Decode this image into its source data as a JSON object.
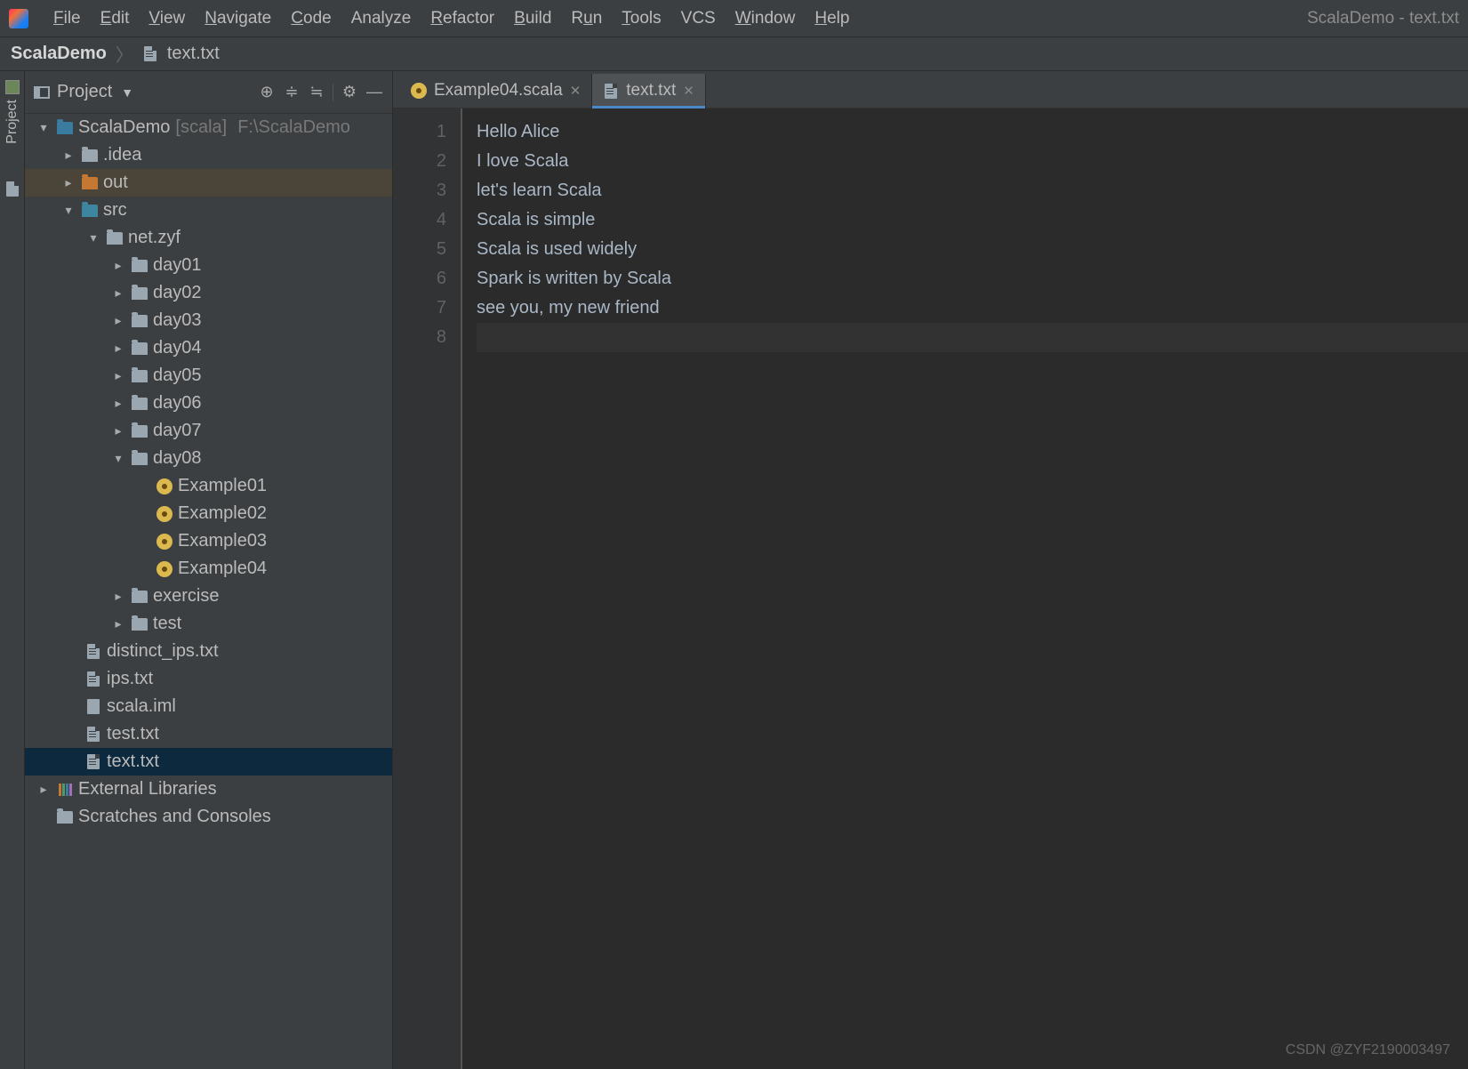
{
  "window_title": "ScalaDemo - text.txt",
  "menus": [
    "File",
    "Edit",
    "View",
    "Navigate",
    "Code",
    "Analyze",
    "Refactor",
    "Build",
    "Run",
    "Tools",
    "VCS",
    "Window",
    "Help"
  ],
  "breadcrumb": {
    "root": "ScalaDemo",
    "file": "text.txt"
  },
  "sidebar_tab_label": "Project",
  "panel": {
    "title": "Project"
  },
  "tree": {
    "root": {
      "name": "ScalaDemo",
      "module": "[scala]",
      "path": "F:\\ScalaDemo"
    },
    "idea": ".idea",
    "out": "out",
    "src": "src",
    "pkg": "net.zyf",
    "days": [
      "day01",
      "day02",
      "day03",
      "day04",
      "day05",
      "day06",
      "day07",
      "day08"
    ],
    "examples": [
      "Example01",
      "Example02",
      "Example03",
      "Example04"
    ],
    "exercise": "exercise",
    "test": "test",
    "files": [
      "distinct_ips.txt",
      "ips.txt",
      "scala.iml",
      "test.txt",
      "text.txt"
    ],
    "ext_lib": "External Libraries",
    "scratches": "Scratches and Consoles"
  },
  "tabs": [
    {
      "label": "Example04.scala",
      "icon": "scala"
    },
    {
      "label": "text.txt",
      "icon": "txt",
      "active": true
    }
  ],
  "editor": {
    "lines": [
      "Hello Alice",
      "I love Scala",
      "let's learn Scala",
      "Scala is simple",
      "Scala is used widely",
      "Spark is written by Scala",
      "see you, my new friend",
      ""
    ]
  },
  "watermark": "CSDN @ZYF2190003497"
}
